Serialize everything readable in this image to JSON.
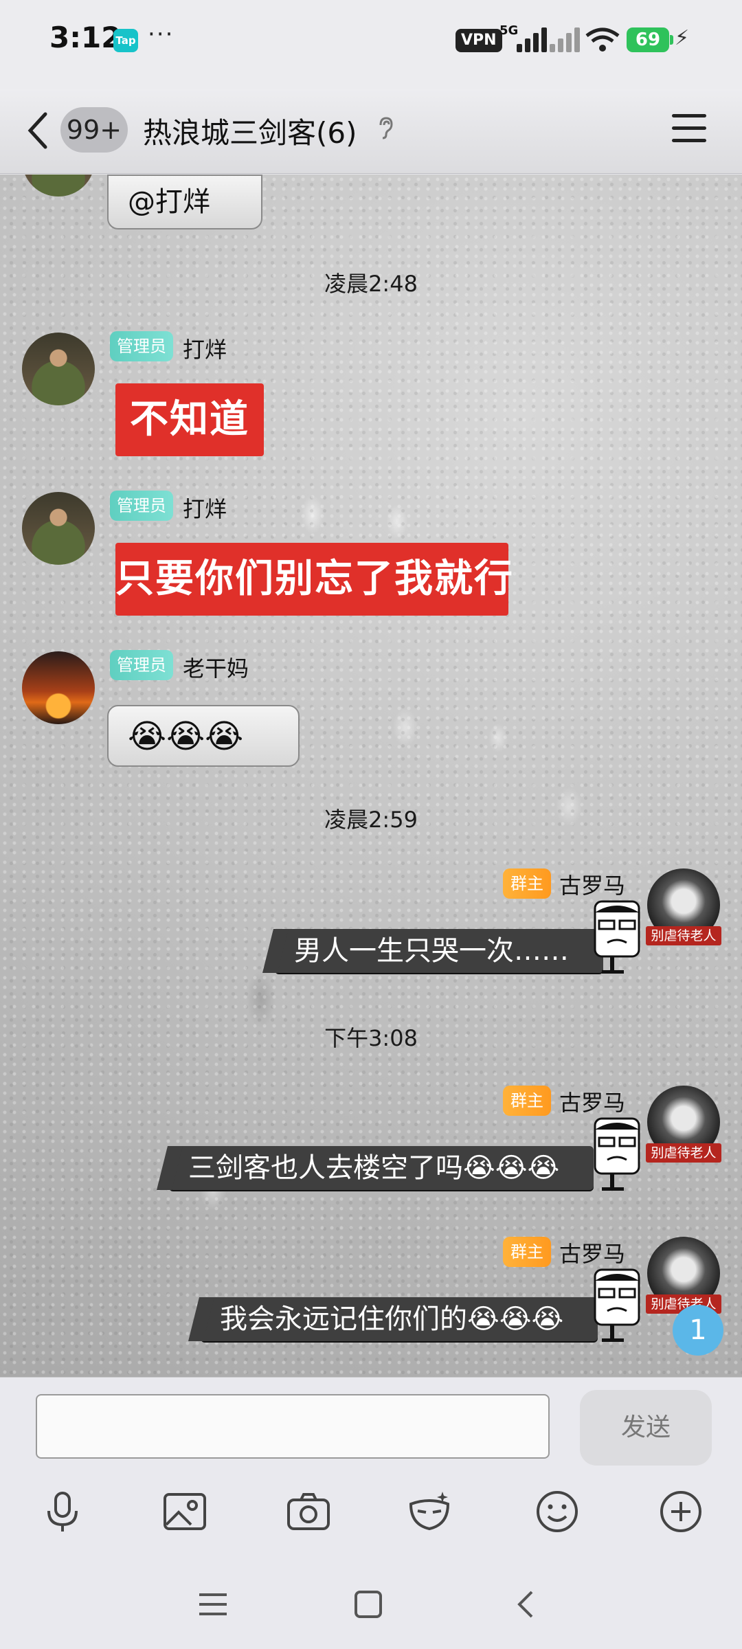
{
  "status": {
    "time": "3:12",
    "app_badge": "Tap",
    "more": "···",
    "vpn": "VPN",
    "network": "5G",
    "battery": "69"
  },
  "header": {
    "unread_count": "99+",
    "title": "热浪城三剑客(6)",
    "ear_icon": "ear-icon"
  },
  "messages": {
    "m0": {
      "text": "@打烊"
    },
    "ts1": "凌晨2:48",
    "m1": {
      "role": "管理员",
      "name": "打烊",
      "sticker": "不知道"
    },
    "m2": {
      "role": "管理员",
      "name": "打烊",
      "sticker": "只要你们别忘了我就行"
    },
    "m3": {
      "role": "管理员",
      "name": "老干妈",
      "text": "😭😭😭"
    },
    "ts2": "凌晨2:59",
    "m4": {
      "role": "群主",
      "name": "古罗马",
      "text": "男人一生只哭一次……",
      "frame": "别虐待老人"
    },
    "ts3": "下午3:08",
    "m5": {
      "role": "群主",
      "name": "古罗马",
      "text": "三剑客也人去楼空了吗😭😭😭",
      "frame": "别虐待老人"
    },
    "m6": {
      "role": "群主",
      "name": "古罗马",
      "text": "我会永远记住你们的😭😭😭",
      "frame": "别虐待老人"
    }
  },
  "unread_bubble": "1",
  "composer": {
    "input_value": "",
    "send_label": "发送"
  },
  "toolbar": [
    "mic-icon",
    "image-icon",
    "camera-icon",
    "mask-icon",
    "emoji-icon",
    "plus-icon"
  ],
  "navbar": [
    "menu-nav-icon",
    "home-nav-icon",
    "back-nav-icon"
  ],
  "colors": {
    "admin_tag": "#5fcfc0",
    "owner_tag": "#ffa52c",
    "red_sticker": "#e0302a",
    "unread": "#5bb7e8",
    "battery": "#2fc25b"
  }
}
